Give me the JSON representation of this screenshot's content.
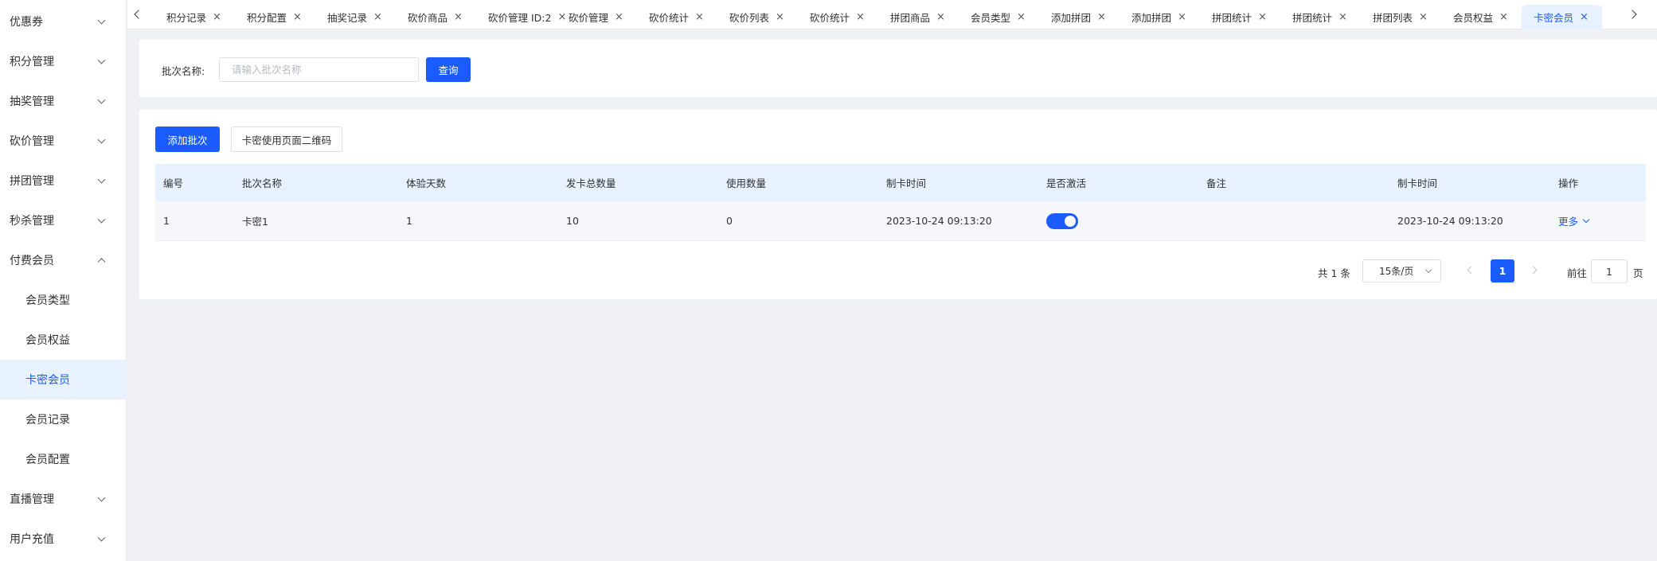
{
  "sidebar": {
    "items": [
      {
        "label": "优惠券",
        "expanded": false
      },
      {
        "label": "积分管理",
        "expanded": false
      },
      {
        "label": "抽奖管理",
        "expanded": false
      },
      {
        "label": "砍价管理",
        "expanded": false
      },
      {
        "label": "拼团管理",
        "expanded": false
      },
      {
        "label": "秒杀管理",
        "expanded": false
      },
      {
        "label": "付费会员",
        "expanded": true
      },
      {
        "label": "直播管理",
        "expanded": false
      },
      {
        "label": "用户充值",
        "expanded": false
      }
    ],
    "subitems": [
      {
        "label": "会员类型"
      },
      {
        "label": "会员权益"
      },
      {
        "label": "卡密会员",
        "active": true
      },
      {
        "label": "会员记录"
      },
      {
        "label": "会员配置"
      }
    ]
  },
  "tabs": [
    {
      "label": "积分记录"
    },
    {
      "label": "积分配置"
    },
    {
      "label": "抽奖记录"
    },
    {
      "label": "砍价商品"
    },
    {
      "label": "砍价管理 ID:2"
    },
    {
      "label": "砍价管理"
    },
    {
      "label": "砍价统计"
    },
    {
      "label": "砍价列表"
    },
    {
      "label": "砍价统计"
    },
    {
      "label": "拼团商品"
    },
    {
      "label": "会员类型"
    },
    {
      "label": "添加拼团"
    },
    {
      "label": "添加拼团"
    },
    {
      "label": "拼团统计"
    },
    {
      "label": "拼团统计"
    },
    {
      "label": "拼团列表"
    },
    {
      "label": "会员权益"
    },
    {
      "label": "卡密会员",
      "active": true
    }
  ],
  "search": {
    "label": "批次名称:",
    "placeholder": "请输入批次名称",
    "value": "",
    "query_label": "查询"
  },
  "toolbar": {
    "add_label": "添加批次",
    "qrcode_label": "卡密使用页面二维码"
  },
  "table": {
    "columns": [
      "编号",
      "批次名称",
      "体验天数",
      "发卡总数量",
      "使用数量",
      "制卡时间",
      "是否激活",
      "备注",
      "制卡时间",
      "操作"
    ],
    "rows": [
      {
        "id": "1",
        "name": "卡密1",
        "days": "1",
        "total": "10",
        "used": "0",
        "created": "2023-10-24 09:13:20",
        "active": true,
        "remark": "",
        "created2": "2023-10-24 09:13:20",
        "action": "更多"
      }
    ]
  },
  "pagination": {
    "total_text": "共 1 条",
    "page_size": "15条/页",
    "current_page": "1",
    "goto_label": "前往",
    "goto_value": "1",
    "unit": "页"
  },
  "colors": {
    "primary": "#1a5cff",
    "active_bg": "#e8f1ff",
    "page_bg": "#f0f1f4"
  }
}
